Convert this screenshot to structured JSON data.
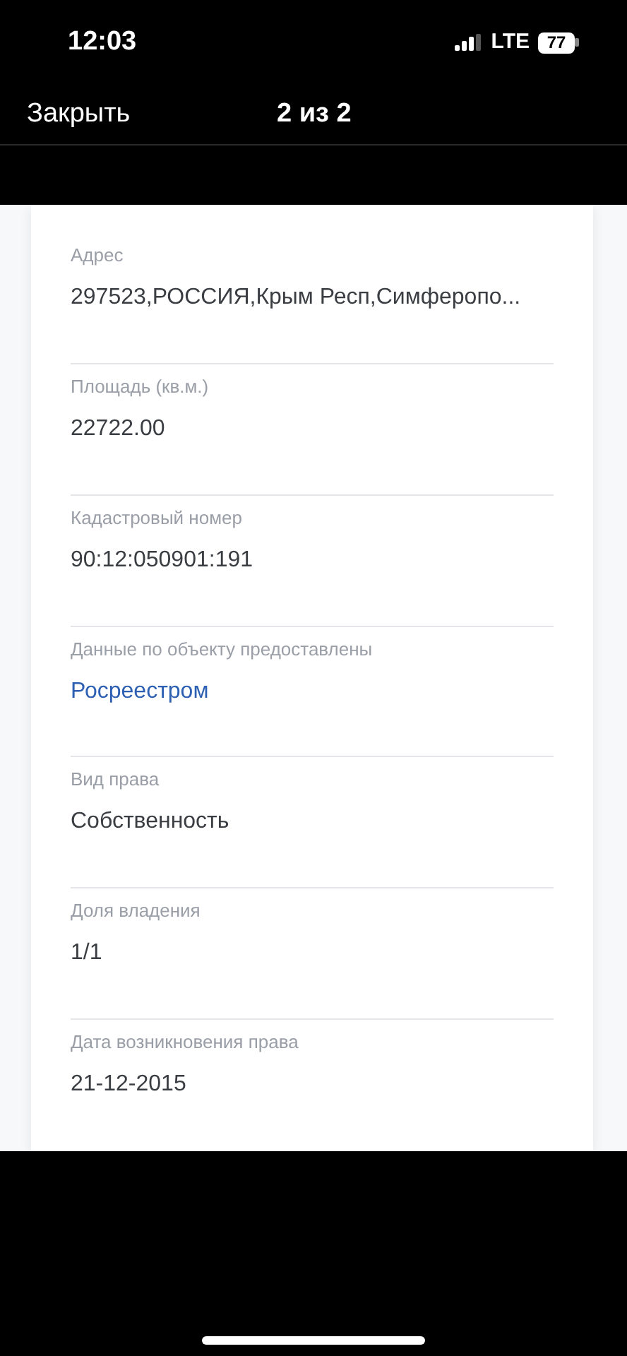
{
  "status_bar": {
    "time": "12:03",
    "network": "LTE",
    "battery": "77"
  },
  "nav_bar": {
    "close": "Закрыть",
    "title": "2 из 2"
  },
  "fields": [
    {
      "label": "Адрес",
      "value": "297523,РОССИЯ,Крым Респ,Симферопо...",
      "kind": "text"
    },
    {
      "label": "Площадь (кв.м.)",
      "value": "22722.00",
      "kind": "text"
    },
    {
      "label": "Кадастровый номер",
      "value": "90:12:050901:191",
      "kind": "text"
    },
    {
      "label": "Данные по объекту предоставлены",
      "value": "Росреестром",
      "kind": "link"
    },
    {
      "label": "Вид права",
      "value": "Собственность",
      "kind": "text"
    },
    {
      "label": "Доля владения",
      "value": "1/1",
      "kind": "text"
    },
    {
      "label": "Дата возникновения права",
      "value": "21-12-2015",
      "kind": "text"
    }
  ]
}
